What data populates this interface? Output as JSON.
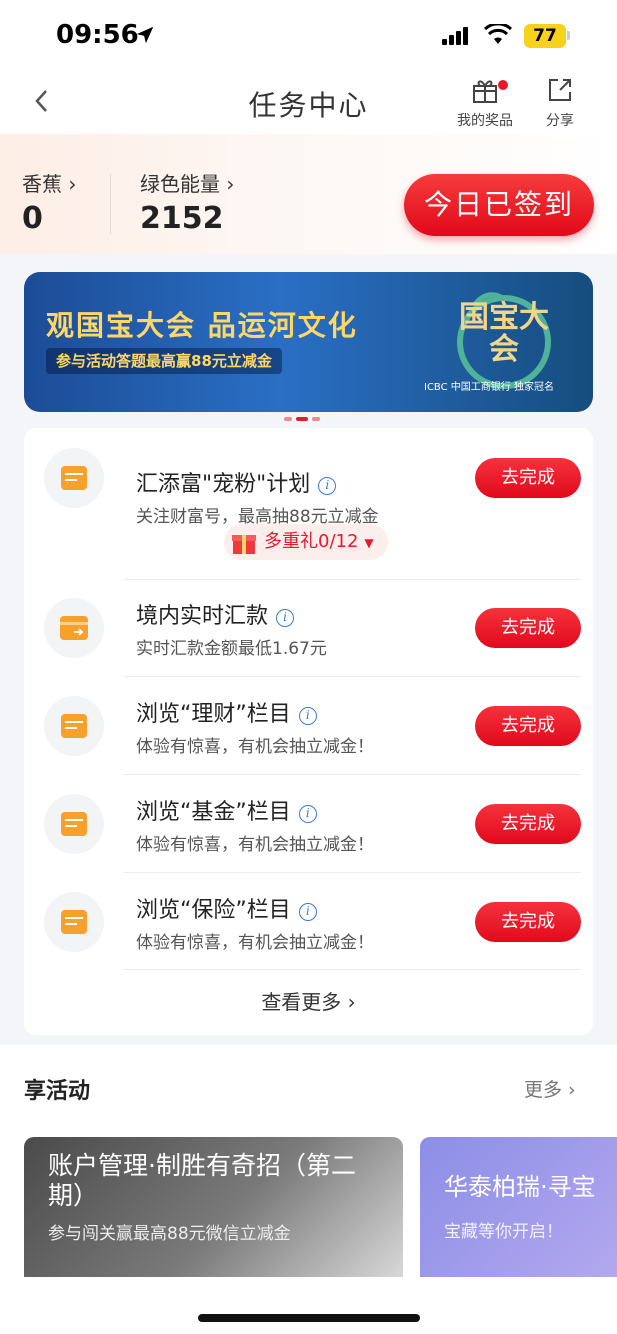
{
  "status_bar": {
    "time": "09:56",
    "battery": "77"
  },
  "nav": {
    "title": "任务中心",
    "prize_label": "我的奖品",
    "share_label": "分享"
  },
  "points": {
    "banana_label": "香蕉 ›",
    "banana_value": "0",
    "energy_label": "绿色能量 ›",
    "energy_value": "2152",
    "signin_label": "今日已签到"
  },
  "banner": {
    "headline": "观国宝大会 品运河文化",
    "subline": "参与活动答题最高赢88元立减金",
    "logo_title": "国宝大会",
    "logo_caption": "ICBC 中国工商银行 独家冠名"
  },
  "tasks": [
    {
      "title": "汇添富\"宠粉\"计划",
      "subtitle": "关注财富号，最高抽88元立减金",
      "button": "去完成"
    },
    {
      "title": "境内实时汇款",
      "subtitle": "实时汇款金额最低1.67元",
      "button": "去完成"
    },
    {
      "title": "浏览“理财”栏目",
      "subtitle": "体验有惊喜，有机会抽立减金！",
      "button": "去完成"
    },
    {
      "title": "浏览“基金”栏目",
      "subtitle": "体验有惊喜，有机会抽立减金！",
      "button": "去完成"
    },
    {
      "title": "浏览“保险”栏目",
      "subtitle": "体验有惊喜，有机会抽立减金！",
      "button": "去完成"
    }
  ],
  "gift": {
    "label": "多重礼0/12"
  },
  "view_more": "查看更多 ›",
  "activities": {
    "header": "享活动",
    "more": "更多 ›",
    "cards": [
      {
        "title": "账户管理·制胜有奇招（第二期）",
        "subtitle": "参与闯关赢最高88元微信立减金"
      },
      {
        "title": "华泰柏瑞·寻宝",
        "subtitle": "宝藏等你开启！"
      }
    ]
  },
  "colors": {
    "accent": "#e8192c",
    "task_icon": "#f7a02c",
    "info": "#3a7bd5"
  }
}
